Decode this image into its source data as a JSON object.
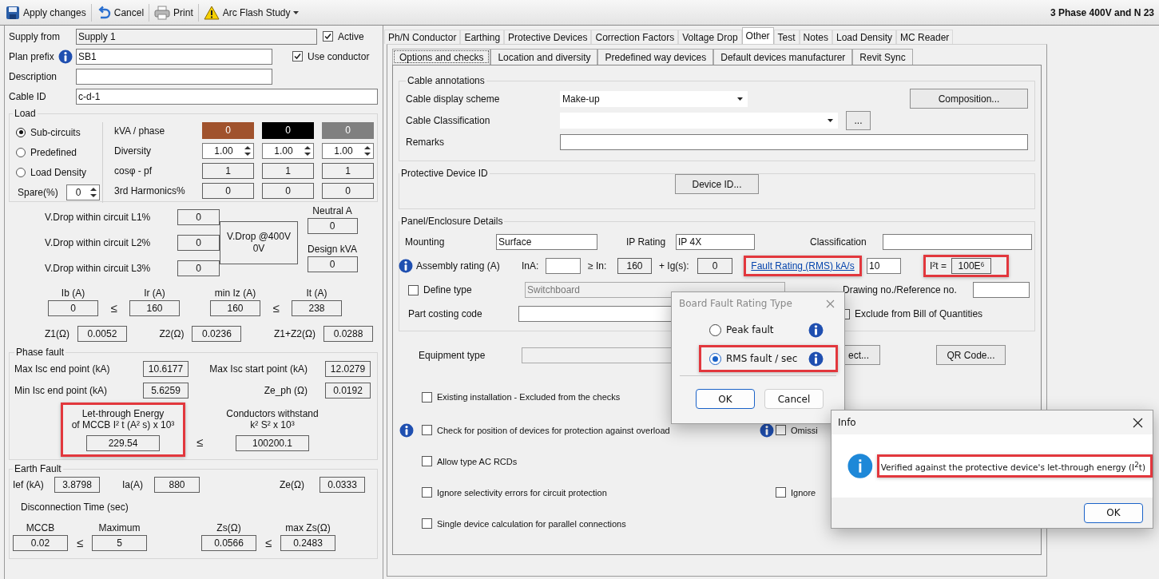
{
  "toolbar": {
    "buttons": [
      {
        "kind": "save",
        "label": "Apply changes",
        "dropdown": false
      },
      {
        "kind": "undo",
        "label": "Cancel",
        "dropdown": false
      },
      {
        "kind": "print",
        "label": "Print",
        "dropdown": false
      },
      {
        "kind": "warning",
        "label": "Arc Flash Study",
        "dropdown": true
      }
    ],
    "caption": "3 Phase 400V and N 23"
  },
  "circuit": {
    "supply_from": {
      "label": "Supply from",
      "value": "Supply 1"
    },
    "active": {
      "label": "Active",
      "checked": true
    },
    "plan_prefix": {
      "label": "Plan prefix",
      "value": "SB1"
    },
    "use_conductor": {
      "label": "Use conductor",
      "checked": true
    },
    "description": {
      "label": "Description"
    },
    "cable_id": {
      "label": "Cable ID",
      "value": "c-d-1"
    }
  },
  "load": {
    "title": "Load",
    "options": [
      {
        "label": "Sub-circuits",
        "selected": true
      },
      {
        "label": "Predefined",
        "selected": false
      },
      {
        "label": "Load Density",
        "selected": false
      }
    ],
    "spare": {
      "label": "Spare(%)",
      "value": "0"
    },
    "rows": [
      {
        "kind": "color",
        "label": "kVA / phase",
        "cells": [
          {
            "value": "0",
            "color": "#a0522d"
          },
          {
            "value": "0",
            "color": "#000000"
          },
          {
            "value": "0",
            "color": "#808080"
          }
        ]
      },
      {
        "kind": "spin",
        "label": "Diversity",
        "cells": [
          {
            "value": "1.00"
          },
          {
            "value": "1.00"
          },
          {
            "value": "1.00"
          }
        ]
      },
      {
        "kind": "readonly",
        "label": "cosφ - pf",
        "cells": [
          {
            "value": "1"
          },
          {
            "value": "1"
          },
          {
            "value": "1"
          }
        ]
      },
      {
        "kind": "readonly",
        "label": "3rd Harmonics%",
        "cells": [
          {
            "value": "0"
          },
          {
            "value": "0"
          },
          {
            "value": "0"
          }
        ]
      }
    ]
  },
  "voltage_drop": {
    "rows": [
      {
        "label": "V.Drop within circuit L1%",
        "value": "0"
      },
      {
        "label": "V.Drop within circuit L2%",
        "value": "0"
      },
      {
        "label": "V.Drop within circuit L3%",
        "value": "0"
      }
    ],
    "summary": [
      "V.Drop @400V",
      "0V"
    ],
    "neutral": {
      "label": "Neutral A",
      "value": "0"
    },
    "design_kva": {
      "label": "Design kVA",
      "value": "0"
    }
  },
  "currents": [
    {
      "kind": "field",
      "label": "Ib (A)",
      "value": "0"
    },
    {
      "kind": "sign",
      "sign": "≤"
    },
    {
      "kind": "field",
      "label": "Ir (A)",
      "value": "160"
    },
    {
      "kind": "field",
      "label": "min Iz (A)",
      "value": "160"
    },
    {
      "kind": "sign",
      "sign": "≤"
    },
    {
      "kind": "field",
      "label": "It (A)",
      "value": "238"
    }
  ],
  "impedances": [
    {
      "label": "Z1(Ω)",
      "value": "0.0052"
    },
    {
      "label": "Z2(Ω)",
      "value": "0.0236"
    },
    {
      "label": "Z1+Z2(Ω)",
      "value": "0.0288"
    }
  ],
  "phase_fault": {
    "title": "Phase fault",
    "rows": [
      [
        {
          "label": "Max Isc end point (kA)",
          "value": "10.6177"
        },
        {
          "label": "Max Isc start point (kA)",
          "value": "12.0279"
        }
      ],
      [
        {
          "label": "Min Isc end point (kA)",
          "value": "5.6259"
        },
        {
          "label": "Ze_ph (Ω)",
          "value": "0.0192"
        }
      ]
    ],
    "let_through": {
      "lines": [
        "Let-through Energy",
        "of MCCB I² t (A² s)  x 10³"
      ],
      "value": "229.54",
      "highlighted": true
    },
    "sign": "≤",
    "withstand": {
      "lines": [
        "Conductors withstand",
        "k² S²  x 10³"
      ],
      "value": "100200.1"
    }
  },
  "earth_fault": {
    "title": "Earth Fault",
    "values": [
      {
        "label": "Ief (kA)",
        "value": "3.8798"
      },
      {
        "label": "Ia(A)",
        "value": "880"
      },
      {
        "label": "Ze(Ω)",
        "value": "0.0333"
      }
    ],
    "disconnection_label": "Disconnection Time (sec)",
    "comparisons": [
      {
        "left": {
          "label": "MCCB",
          "value": "0.02"
        },
        "sign": "≤",
        "right": {
          "label": "Maximum",
          "value": "5"
        }
      },
      {
        "left": {
          "label": "Zs(Ω)",
          "value": "0.0566"
        },
        "sign": "≤",
        "right": {
          "label": "max Zs(Ω)",
          "value": "0.2483"
        }
      }
    ]
  },
  "tabs": [
    {
      "label": "Ph/N Conductor",
      "selected": false
    },
    {
      "label": "Earthing",
      "selected": false
    },
    {
      "label": "Protective Devices",
      "selected": false
    },
    {
      "label": "Correction Factors",
      "selected": false
    },
    {
      "label": "Voltage Drop",
      "selected": false
    },
    {
      "label": "Other",
      "selected": true
    },
    {
      "label": "Test",
      "selected": false
    },
    {
      "label": "Notes",
      "selected": false
    },
    {
      "label": "Load Density",
      "selected": false
    },
    {
      "label": "MC Reader",
      "selected": false
    }
  ],
  "subtabs": [
    {
      "label": "Options and checks",
      "selected": true
    },
    {
      "label": "Location and diversity",
      "selected": false
    },
    {
      "label": "Predefined way devices",
      "selected": false
    },
    {
      "label": "Default devices manufacturer",
      "selected": false
    },
    {
      "label": "Revit Sync",
      "selected": false
    }
  ],
  "cable_annotations": {
    "title": "Cable annotations",
    "display_scheme": {
      "label": "Cable display scheme",
      "value": "Make-up"
    },
    "classification": {
      "label": "Cable Classification"
    },
    "browse_button": "...",
    "remarks": {
      "label": "Remarks"
    },
    "composition_button": "Composition..."
  },
  "protective_device_id": {
    "title": "Protective Device ID",
    "button": "Device ID..."
  },
  "panel": {
    "title": "Panel/Enclosure Details",
    "mounting": {
      "label": "Mounting",
      "value": "Surface"
    },
    "ip_rating": {
      "label": "IP Rating",
      "value": "IP 4X"
    },
    "classification": {
      "label": "Classification"
    },
    "assembly": {
      "label": "Assembly rating (A)",
      "ina": {
        "label": "InA:"
      },
      "in": {
        "label": "≥  In:",
        "value": "160"
      },
      "ig": {
        "label": "+ Ig(s):",
        "value": "0"
      }
    },
    "fault_rating": {
      "label": "Fault Rating (RMS) kA/s",
      "value": "10",
      "highlighted": true
    },
    "i2t": {
      "label": "I²t =",
      "value": "100E⁶",
      "highlighted": true
    },
    "define_type": {
      "label": "Define type",
      "checked": false,
      "value": "Switchboard"
    },
    "drawing_no": {
      "label": "Drawing no./Reference no."
    },
    "part_costing": {
      "label": "Part costing code"
    },
    "exclude_boq": {
      "label": "Exclude from Bill of Quantities",
      "checked": false
    }
  },
  "equipment": {
    "label": "Equipment type",
    "select_button": "ect...",
    "qr_button": "QR Code..."
  },
  "checks": [
    {
      "cells": [
        {
          "label": "Existing installation - Excluded from the checks",
          "checked": false,
          "info": false
        }
      ]
    },
    {
      "cells": [
        {
          "label": "Check for position of devices for protection against overload",
          "checked": false,
          "info": true
        },
        {
          "label": "Omissi",
          "checked": false,
          "info": true
        }
      ]
    },
    {
      "cells": [
        {
          "label": "Allow type AC RCDs",
          "checked": false,
          "info": false
        }
      ]
    },
    {
      "cells": [
        {
          "label": "Ignore selectivity errors for circuit protection",
          "checked": false,
          "info": false
        },
        {
          "label": "Ignore",
          "checked": false,
          "info": false
        }
      ]
    },
    {
      "cells": [
        {
          "label": "Single device calculation for parallel connections",
          "checked": false,
          "info": false
        }
      ]
    }
  ],
  "fault_dialog": {
    "title": "Board Fault Rating Type",
    "options": [
      {
        "label": "Peak fault",
        "selected": false,
        "highlighted": false
      },
      {
        "label": "RMS fault / sec",
        "selected": true,
        "highlighted": true
      }
    ],
    "buttons": [
      {
        "label": "OK",
        "default": true
      },
      {
        "label": "Cancel",
        "default": false
      }
    ]
  },
  "info_dialog": {
    "title": "Info",
    "message": "Verified against the protective device's let-through energy (I$^{2}$t)",
    "highlighted": true,
    "button": "OK"
  }
}
